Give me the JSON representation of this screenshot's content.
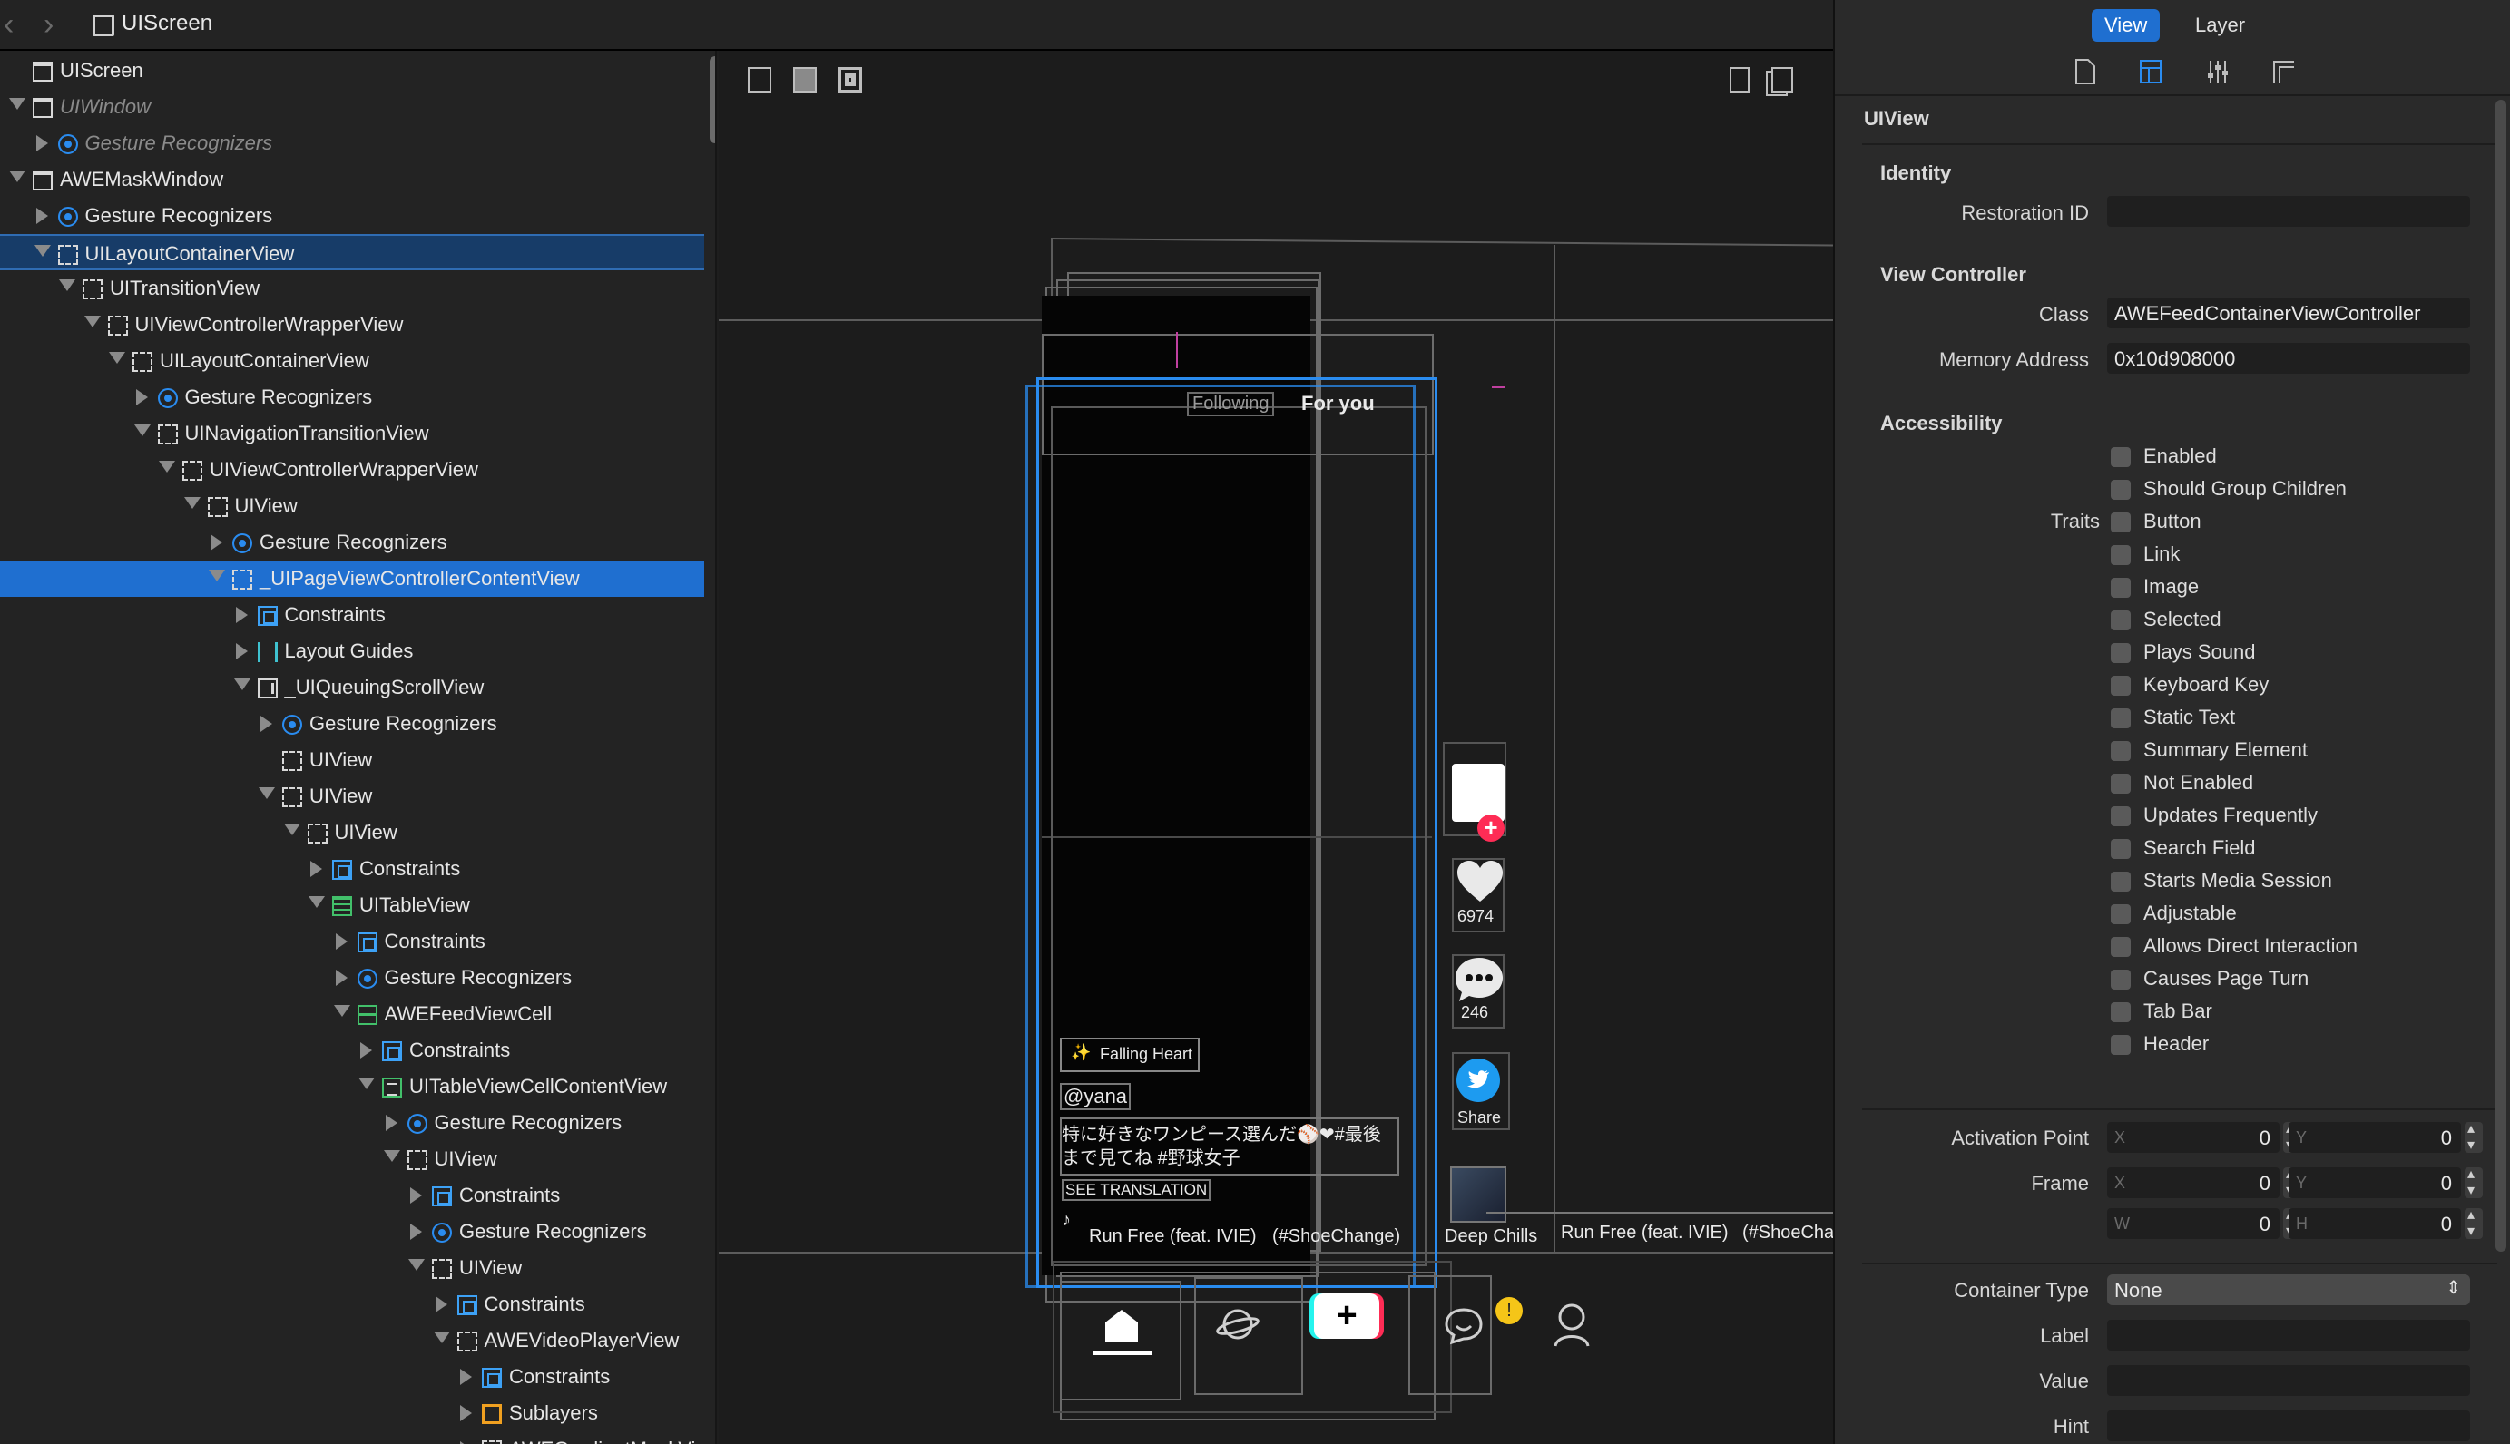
{
  "topbar": {
    "breadcrumb": "UIScreen"
  },
  "tree": [
    {
      "label": "UIScreen",
      "indent": 0,
      "tri": "",
      "icon": "window"
    },
    {
      "label": "UIWindow",
      "indent": 0,
      "tri": "down",
      "icon": "window",
      "dim": true
    },
    {
      "label": "Gesture Recognizers",
      "indent": 1,
      "tri": "right",
      "icon": "gesture",
      "dim": true
    },
    {
      "label": "AWEMaskWindow",
      "indent": 0,
      "tri": "down",
      "icon": "window"
    },
    {
      "label": "Gesture Recognizers",
      "indent": 1,
      "tri": "right",
      "icon": "gesture"
    },
    {
      "label": "UILayoutContainerView",
      "indent": 1,
      "tri": "down",
      "icon": "view",
      "sel": "soft"
    },
    {
      "label": "UITransitionView",
      "indent": 2,
      "tri": "down",
      "icon": "view"
    },
    {
      "label": "UIViewControllerWrapperView",
      "indent": 3,
      "tri": "down",
      "icon": "view"
    },
    {
      "label": "UILayoutContainerView",
      "indent": 4,
      "tri": "down",
      "icon": "view"
    },
    {
      "label": "Gesture Recognizers",
      "indent": 5,
      "tri": "right",
      "icon": "gesture"
    },
    {
      "label": "UINavigationTransitionView",
      "indent": 5,
      "tri": "down",
      "icon": "view"
    },
    {
      "label": "UIViewControllerWrapperView",
      "indent": 6,
      "tri": "down",
      "icon": "view"
    },
    {
      "label": "UIView",
      "indent": 7,
      "tri": "down",
      "icon": "view"
    },
    {
      "label": "Gesture Recognizers",
      "indent": 8,
      "tri": "right",
      "icon": "gesture"
    },
    {
      "label": "_UIPageViewControllerContentView",
      "indent": 8,
      "tri": "down",
      "icon": "view",
      "sel": "strong"
    },
    {
      "label": "Constraints",
      "indent": 9,
      "tri": "right",
      "icon": "constraint"
    },
    {
      "label": "Layout Guides",
      "indent": 9,
      "tri": "right",
      "icon": "guides"
    },
    {
      "label": "_UIQueuingScrollView",
      "indent": 9,
      "tri": "down",
      "icon": "scroll"
    },
    {
      "label": "Gesture Recognizers",
      "indent": 10,
      "tri": "right",
      "icon": "gesture"
    },
    {
      "label": "UIView",
      "indent": 10,
      "tri": "",
      "icon": "view"
    },
    {
      "label": "UIView",
      "indent": 10,
      "tri": "down",
      "icon": "view"
    },
    {
      "label": "UIView",
      "indent": 11,
      "tri": "down",
      "icon": "view"
    },
    {
      "label": "Constraints",
      "indent": 12,
      "tri": "right",
      "icon": "constraint"
    },
    {
      "label": "UITableView",
      "indent": 12,
      "tri": "down",
      "icon": "table"
    },
    {
      "label": "Constraints",
      "indent": 13,
      "tri": "right",
      "icon": "constraint"
    },
    {
      "label": "Gesture Recognizers",
      "indent": 13,
      "tri": "right",
      "icon": "gesture"
    },
    {
      "label": "AWEFeedViewCell",
      "indent": 13,
      "tri": "down",
      "icon": "cell"
    },
    {
      "label": "Constraints",
      "indent": 14,
      "tri": "right",
      "icon": "constraint"
    },
    {
      "label": "UITableViewCellContentView",
      "indent": 14,
      "tri": "down",
      "icon": "cellcontent"
    },
    {
      "label": "Gesture Recognizers",
      "indent": 15,
      "tri": "right",
      "icon": "gesture"
    },
    {
      "label": "UIView",
      "indent": 15,
      "tri": "down",
      "icon": "view"
    },
    {
      "label": "Constraints",
      "indent": 16,
      "tri": "right",
      "icon": "constraint"
    },
    {
      "label": "Gesture Recognizers",
      "indent": 16,
      "tri": "right",
      "icon": "gesture"
    },
    {
      "label": "UIView",
      "indent": 16,
      "tri": "down",
      "icon": "view"
    },
    {
      "label": "Constraints",
      "indent": 17,
      "tri": "right",
      "icon": "constraint"
    },
    {
      "label": "AWEVideoPlayerView",
      "indent": 17,
      "tri": "down",
      "icon": "view"
    },
    {
      "label": "Constraints",
      "indent": 18,
      "tri": "right",
      "icon": "constraint"
    },
    {
      "label": "Sublayers",
      "indent": 18,
      "tri": "right",
      "icon": "layer"
    },
    {
      "label": "AWEGradientMaskView",
      "indent": 18,
      "tri": "right",
      "icon": "view"
    }
  ],
  "canvas": {
    "tab_following": "Following",
    "tab_for_you": "For you",
    "like_count": "6974",
    "comment_count": "246",
    "share_label": "Share",
    "music_tag": "Falling Heart",
    "username": "@yana",
    "caption_line1": "特に好きなワンピース選んだ⚾❤#最後",
    "caption_line2": "まで見てね #野球女子",
    "see_translation": "SEE TRANSLATION",
    "song_1": "Run Free (feat. IVIE)",
    "song_1_tag": "(#ShoeChange)",
    "song_2": "Deep Chills",
    "song_3": "Run Free (feat. IVIE)",
    "song_3_tag": "(#ShoeCha",
    "accent": "#2a8cf0",
    "badge_color": "#fe2c55"
  },
  "inspector": {
    "seg_view": "View",
    "seg_layer": "Layer",
    "header": "UIView",
    "identity_title": "Identity",
    "restoration_label": "Restoration ID",
    "restoration_value": "",
    "vc_title": "View Controller",
    "class_label": "Class",
    "class_value": "AWEFeedContainerViewController",
    "memory_label": "Memory Address",
    "memory_value": "0x10d908000",
    "accessibility_title": "Accessibility",
    "enabled_label": "Enabled",
    "group_label": "Should Group Children",
    "traits_label": "Traits",
    "traits": [
      "Button",
      "Link",
      "Image",
      "Selected",
      "Plays Sound",
      "Keyboard Key",
      "Static Text",
      "Summary Element",
      "Not Enabled",
      "Updates Frequently",
      "Search Field",
      "Starts Media Session",
      "Adjustable",
      "Allows Direct Interaction",
      "Causes Page Turn",
      "Tab Bar",
      "Header"
    ],
    "activation_label": "Activation Point",
    "frame_label": "Frame",
    "ph_x": "X",
    "ph_y": "Y",
    "ph_w": "W",
    "ph_h": "H",
    "activation_x": "0",
    "activation_y": "0",
    "frame_x": "0",
    "frame_y": "0",
    "frame_w": "0",
    "frame_h": "0",
    "container_label": "Container Type",
    "container_value": "None",
    "label_label": "Label",
    "value_label": "Value",
    "hint_label": "Hint"
  }
}
